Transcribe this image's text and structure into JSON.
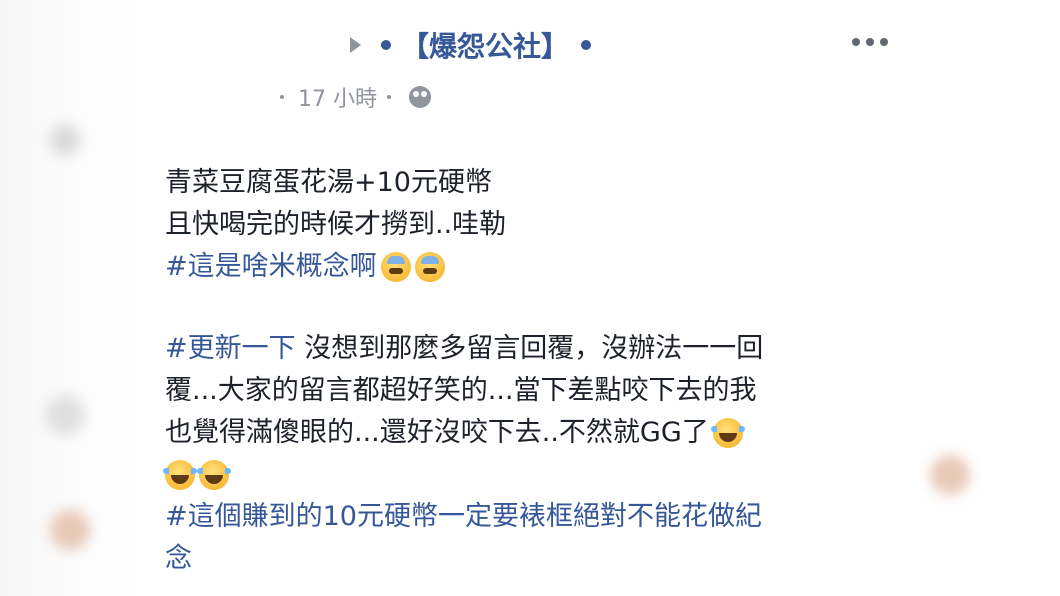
{
  "header": {
    "page_name": "【爆怨公社】"
  },
  "meta": {
    "time_ago": "17 小時",
    "audience_icon": "friends-icon"
  },
  "post": {
    "line1": "青菜豆腐蛋花湯+10元硬幣",
    "line2": "且快喝完的時候才撈到..哇勒",
    "hashtag1": "#這是啥米概念啊",
    "hashtag2": "#更新一下",
    "line4_rest": " 沒想到那麼多留言回覆，沒辦法一一回",
    "line5": "覆...大家的留言都超好笑的...當下差點咬下去的我",
    "line6": "也覺得滿傻眼的...還好沒咬下去..不然就GG了",
    "hashtag3_part1": "#這個賺到的10元硬幣一定要裱框絕對不能花做紀",
    "hashtag3_part2": "念"
  },
  "colors": {
    "link": "#365899",
    "text": "#1d2129",
    "meta": "#90949c"
  }
}
